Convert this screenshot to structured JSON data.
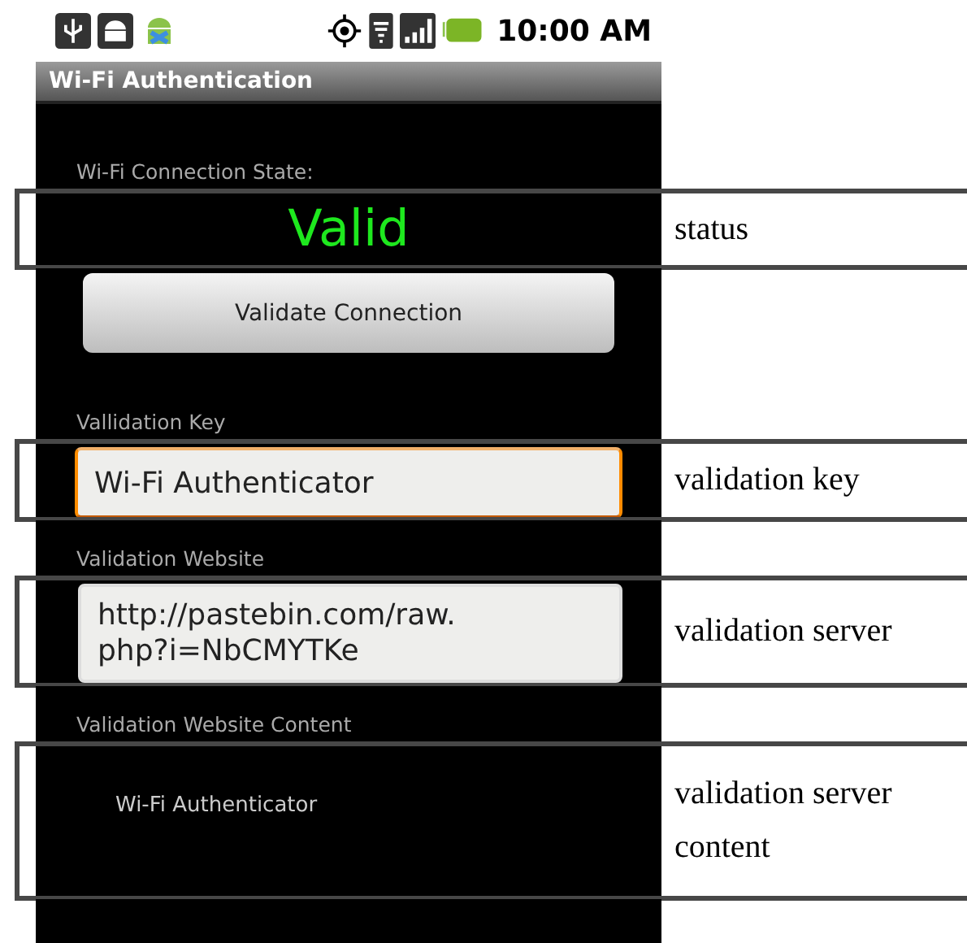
{
  "status_bar": {
    "time": "10:00 AM"
  },
  "app_bar": {
    "title": "Wi-Fi Authentication"
  },
  "connection_state": {
    "label": "Wi-Fi Connection State:",
    "value": "Valid",
    "annotation": "status"
  },
  "validate_button": {
    "label": "Validate Connection"
  },
  "fields": [
    {
      "label": "Vallidation Key",
      "value": "Wi-Fi Authenticator",
      "focused": true,
      "annotation": "validation key"
    },
    {
      "label": "Validation Website",
      "value": "http://pastebin.com/raw.php?i=NbCMYTKe",
      "focused": false,
      "annotation": "validation server"
    }
  ],
  "content": {
    "label": "Validation Website Content",
    "value": "Wi-Fi Authenticator",
    "annotation": "validation server content"
  }
}
